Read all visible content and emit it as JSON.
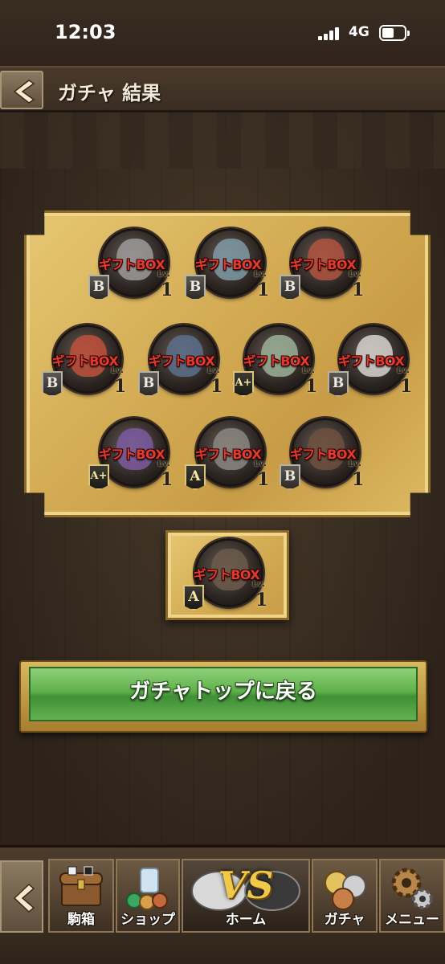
{
  "status_bar": {
    "time": "12:03",
    "network": "4G"
  },
  "header": {
    "title": "ガチャ 結果"
  },
  "results": [
    {
      "gift": "ギフトBOX",
      "rank": "B",
      "lv_label": "Lv.",
      "lv": "1",
      "face": "#9c9a9a"
    },
    {
      "gift": "ギフトBOX",
      "rank": "B",
      "lv_label": "Lv.",
      "lv": "1",
      "face": "#7f9aa6"
    },
    {
      "gift": "ギフトBOX",
      "rank": "B",
      "lv_label": "Lv.",
      "lv": "1",
      "face": "#b0533e"
    },
    {
      "gift": "ギフトBOX",
      "rank": "B",
      "lv_label": "Lv.",
      "lv": "1",
      "face": "#c0503a"
    },
    {
      "gift": "ギフトBOX",
      "rank": "B",
      "lv_label": "Lv.",
      "lv": "1",
      "face": "#5a6e8a"
    },
    {
      "gift": "ギフトBOX",
      "rank": "A+",
      "lv_label": "Lv.",
      "lv": "1",
      "face": "#9ab096"
    },
    {
      "gift": "ギフトBOX",
      "rank": "B",
      "lv_label": "Lv.",
      "lv": "1",
      "face": "#d6d3cf"
    },
    {
      "gift": "ギフトBOX",
      "rank": "A+",
      "lv_label": "Lv.",
      "lv": "1",
      "face": "#7b5aa0"
    },
    {
      "gift": "ギフトBOX",
      "rank": "A",
      "lv_label": "Lv.",
      "lv": "1",
      "face": "#8a8680"
    },
    {
      "gift": "ギフトBOX",
      "rank": "B",
      "lv_label": "Lv.",
      "lv": "1",
      "face": "#6e5040"
    }
  ],
  "single_result": {
    "gift": "ギフトBOX",
    "rank": "A",
    "lv_label": "Lv.",
    "lv": "1",
    "face": "#6b5a4a"
  },
  "return_button": {
    "label": "ガチャトップに戻る"
  },
  "bottom_nav": {
    "items": [
      {
        "label": "駒箱",
        "icon": "chest-icon"
      },
      {
        "label": "ショップ",
        "icon": "coins-icon"
      },
      {
        "label": "ホーム",
        "icon": "vs-icon",
        "vs": "VS"
      },
      {
        "label": "ガチャ",
        "icon": "gacha-coins-icon"
      },
      {
        "label": "メニュー",
        "icon": "gear-icon"
      }
    ]
  },
  "colors": {
    "gift_label": "#e23b2e",
    "board": "#d4ad55",
    "button_green": "#5fb14a"
  }
}
